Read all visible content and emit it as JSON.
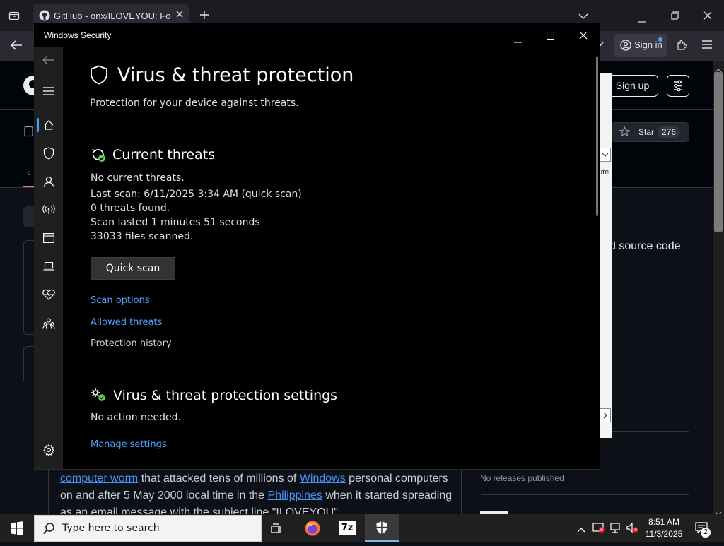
{
  "browser": {
    "tab_title": "GitHub - onx/ILOVEYOU: Forma",
    "sign_in_label": "Sign in"
  },
  "github": {
    "sign_up_label": "Sign up",
    "star_label": "Star",
    "star_count": "276",
    "about_fragment": "d source code",
    "releases_text": "No releases published",
    "readme": {
      "link1": "computer worm",
      "text1": " that attacked tens of millions of ",
      "link2": "Windows",
      "text2": " personal computers on and after 5 May 2000 local time in the ",
      "link3": "Philippines",
      "text3": " when it started spreading as an email message with the subject line \"ILOVEYOU\""
    }
  },
  "ghost_panel": {
    "fragment": "ute"
  },
  "windows_security": {
    "window_title": "Windows Security",
    "page_title": "Virus & threat protection",
    "page_subtitle": "Protection for your device against threats.",
    "current_threats": {
      "title": "Current threats",
      "status": "No current threats.",
      "last_scan": "Last scan: 6/11/2025 3:34 AM (quick scan)",
      "threats_found": "0 threats found.",
      "duration": "Scan lasted 1 minutes 51 seconds",
      "files_scanned": "33033 files scanned.",
      "quick_scan_label": "Quick scan",
      "scan_options_label": "Scan options",
      "allowed_threats_label": "Allowed threats",
      "protection_history_label": "Protection history"
    },
    "settings": {
      "title": "Virus & threat protection settings",
      "status": "No action needed.",
      "manage_label": "Manage settings"
    },
    "sidebar_icons": [
      "back-icon",
      "menu-icon",
      "home-icon",
      "shield-icon",
      "account-icon",
      "firewall-icon",
      "app-browser-icon",
      "device-security-icon",
      "device-health-icon",
      "family-icon",
      "settings-icon"
    ],
    "accent_color": "#4ca1ff",
    "status_ok_color": "#6ccb5f"
  },
  "taskbar": {
    "search_placeholder": "Type here to search",
    "time": "8:51 AM",
    "date": "11/3/2025",
    "notification_count": "2",
    "apps": [
      "task-view-icon",
      "firefox-icon",
      "7zip-icon",
      "windows-security-icon"
    ],
    "app_7zip_label": "7z"
  }
}
